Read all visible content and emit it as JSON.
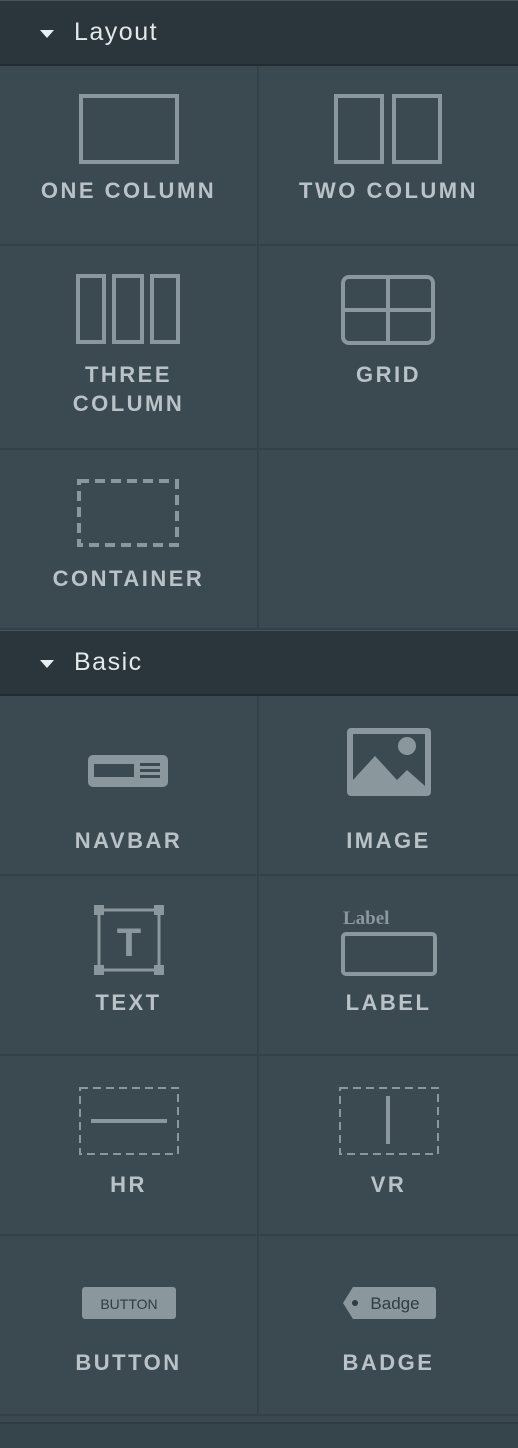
{
  "sections": [
    {
      "title": "Layout",
      "items": [
        {
          "label": "ONE COLUMN",
          "icon": "one-column-icon"
        },
        {
          "label": "TWO COLUMN",
          "icon": "two-column-icon"
        },
        {
          "label": "THREE\nCOLUMN",
          "label_line1": "THREE",
          "label_line2": "COLUMN",
          "icon": "three-column-icon"
        },
        {
          "label": "GRID",
          "icon": "grid-icon"
        },
        {
          "label": "CONTAINER",
          "icon": "container-icon"
        }
      ]
    },
    {
      "title": "Basic",
      "items": [
        {
          "label": "NAVBAR",
          "icon": "navbar-icon"
        },
        {
          "label": "IMAGE",
          "icon": "image-icon"
        },
        {
          "label": "TEXT",
          "icon": "text-icon",
          "icon_text": "T"
        },
        {
          "label": "LABEL",
          "icon": "label-icon",
          "icon_text": "Label"
        },
        {
          "label": "HR",
          "icon": "hr-icon"
        },
        {
          "label": "VR",
          "icon": "vr-icon"
        },
        {
          "label": "BUTTON",
          "icon": "button-icon",
          "icon_text": "BUTTON"
        },
        {
          "label": "BADGE",
          "icon": "badge-icon",
          "icon_text": "Badge"
        }
      ]
    }
  ],
  "colors": {
    "panel_bg": "#3b4950",
    "header_bg": "#2b363c",
    "icon": "#8a979d",
    "label": "#b9c2c6",
    "header_text": "#e3e8ea"
  }
}
